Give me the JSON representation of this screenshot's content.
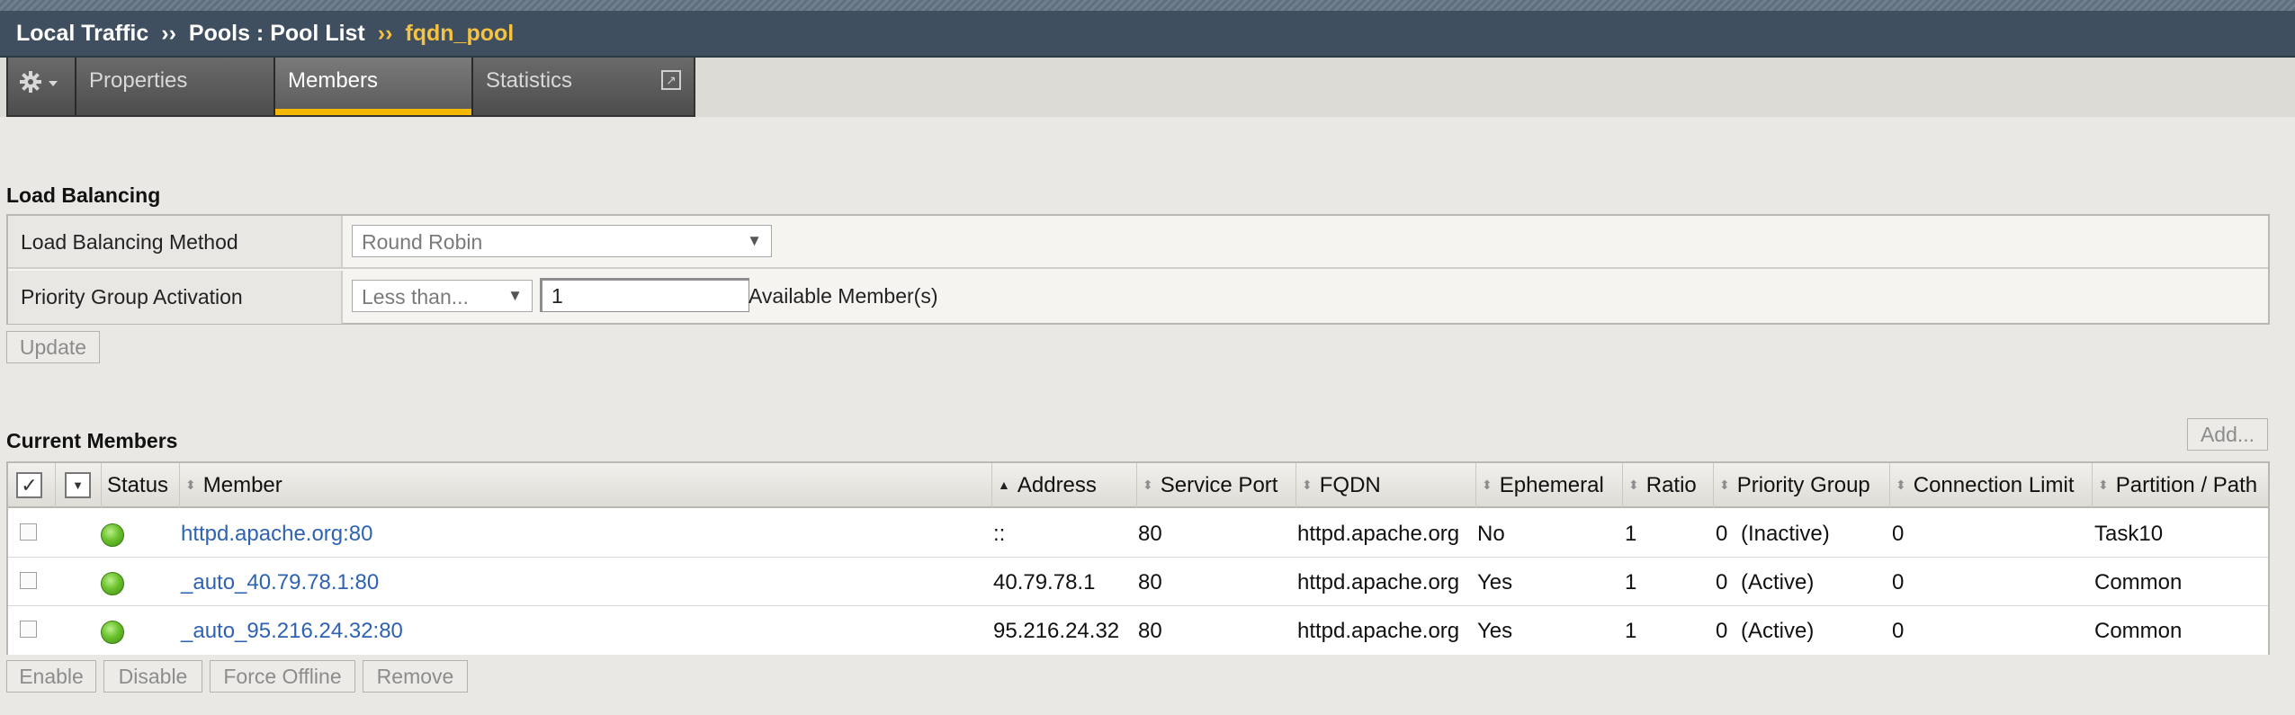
{
  "breadcrumb": {
    "part1": "Local Traffic",
    "sep1": "››",
    "part2": "Pools : Pool List",
    "sep2": "››",
    "current": "fqdn_pool"
  },
  "tabs": [
    {
      "label": "Properties"
    },
    {
      "label": "Members",
      "active": true
    },
    {
      "label": "Statistics"
    }
  ],
  "icons": {
    "gear": "gear-icon",
    "external": "external-link-icon"
  },
  "load_balancing": {
    "title": "Load Balancing",
    "method_label": "Load Balancing Method",
    "method_value": "Round Robin",
    "priority_label": "Priority Group Activation",
    "priority_select": "Less than...",
    "priority_value": "1",
    "priority_suffix": "Available Member(s)",
    "update_button": "Update"
  },
  "members": {
    "title": "Current Members",
    "add_button": "Add...",
    "columns": [
      "Status",
      "Member",
      "Address",
      "Service Port",
      "FQDN",
      "Ephemeral",
      "Ratio",
      "Priority Group",
      "Connection Limit",
      "Partition / Path"
    ],
    "rows": [
      {
        "member": "httpd.apache.org:80",
        "address": "::",
        "port": "80",
        "fqdn": "httpd.apache.org",
        "ephemeral": "No",
        "ratio": "1",
        "priority": "0",
        "priority_state": "(Inactive)",
        "conn_limit": "0",
        "partition": "Task10"
      },
      {
        "member": "_auto_40.79.78.1:80",
        "address": "40.79.78.1",
        "port": "80",
        "fqdn": "httpd.apache.org",
        "ephemeral": "Yes",
        "ratio": "1",
        "priority": "0",
        "priority_state": "(Active)",
        "conn_limit": "0",
        "partition": "Common"
      },
      {
        "member": "_auto_95.216.24.32:80",
        "address": "95.216.24.32",
        "port": "80",
        "fqdn": "httpd.apache.org",
        "ephemeral": "Yes",
        "ratio": "1",
        "priority": "0",
        "priority_state": "(Active)",
        "conn_limit": "0",
        "partition": "Common"
      }
    ],
    "actions": {
      "enable": "Enable",
      "disable": "Disable",
      "force_offline": "Force Offline",
      "remove": "Remove"
    }
  },
  "colors": {
    "header_bg": "#3f4f5f",
    "accent": "#f5c242",
    "link": "#2e62b3",
    "status_green": "#6cc22d"
  }
}
